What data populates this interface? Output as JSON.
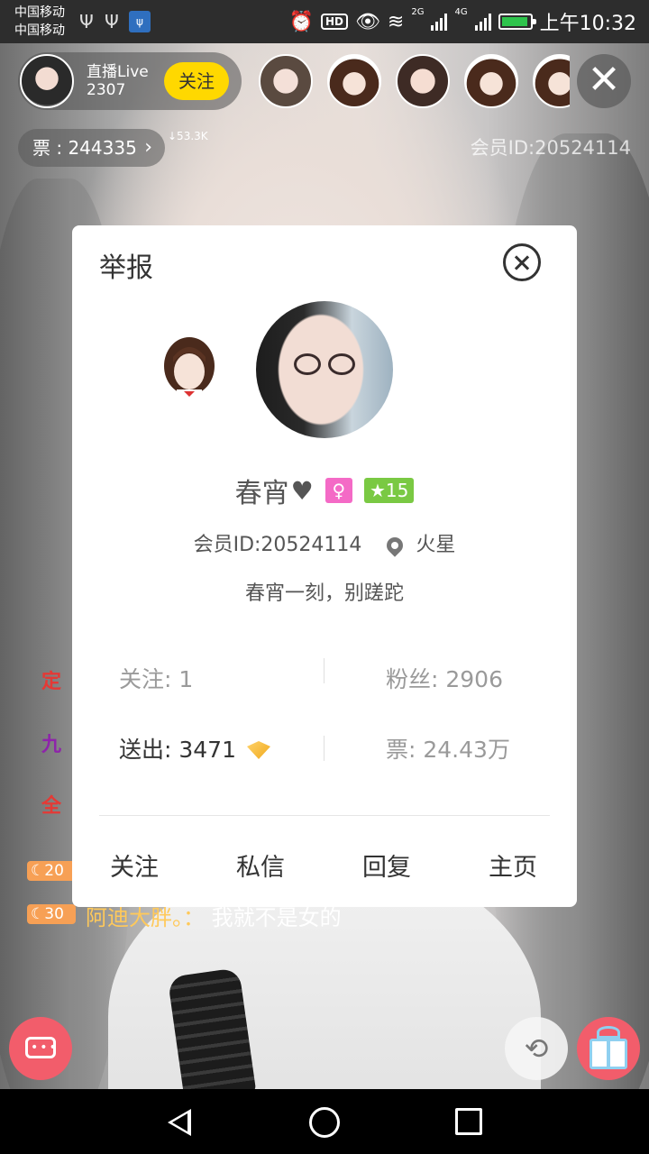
{
  "status_bar": {
    "carrier_1": "中国移动",
    "carrier_2": "中国移动",
    "net_2g": "2G",
    "net_4g": "4G",
    "hd": "HD",
    "time": "上午10:32"
  },
  "live": {
    "host_name": "直播Live",
    "host_id": "2307",
    "follow_label": "关注",
    "tickets": "票 : 244335",
    "ticket_delta": "↓53.3K",
    "member_id": "会员ID:20524114"
  },
  "chat": {
    "partials": [
      "定",
      "九",
      "全"
    ],
    "level_20": "20",
    "level_30": "30",
    "user": "阿迪大胖。：",
    "text": "我就不是女的"
  },
  "modal": {
    "report_label": "举报",
    "nickname": "春宵",
    "heart": "♥",
    "gender_symbol": "♀",
    "level": "★15",
    "member_id": "会员ID:20524114",
    "location": "火星",
    "signature": "春宵一刻，别蹉跎",
    "stats": {
      "following": "关注: 1",
      "fans": "粉丝: 2906",
      "sent": "送出: 3471",
      "tickets": "票: 24.43万"
    },
    "actions": {
      "follow": "关注",
      "message": "私信",
      "reply": "回复",
      "home": "主页"
    }
  },
  "colors": {
    "follow_yellow": "#ffd800",
    "accent_pink": "#f25d6b",
    "gender_pink": "#f46ac6",
    "level_green": "#7ac943"
  }
}
